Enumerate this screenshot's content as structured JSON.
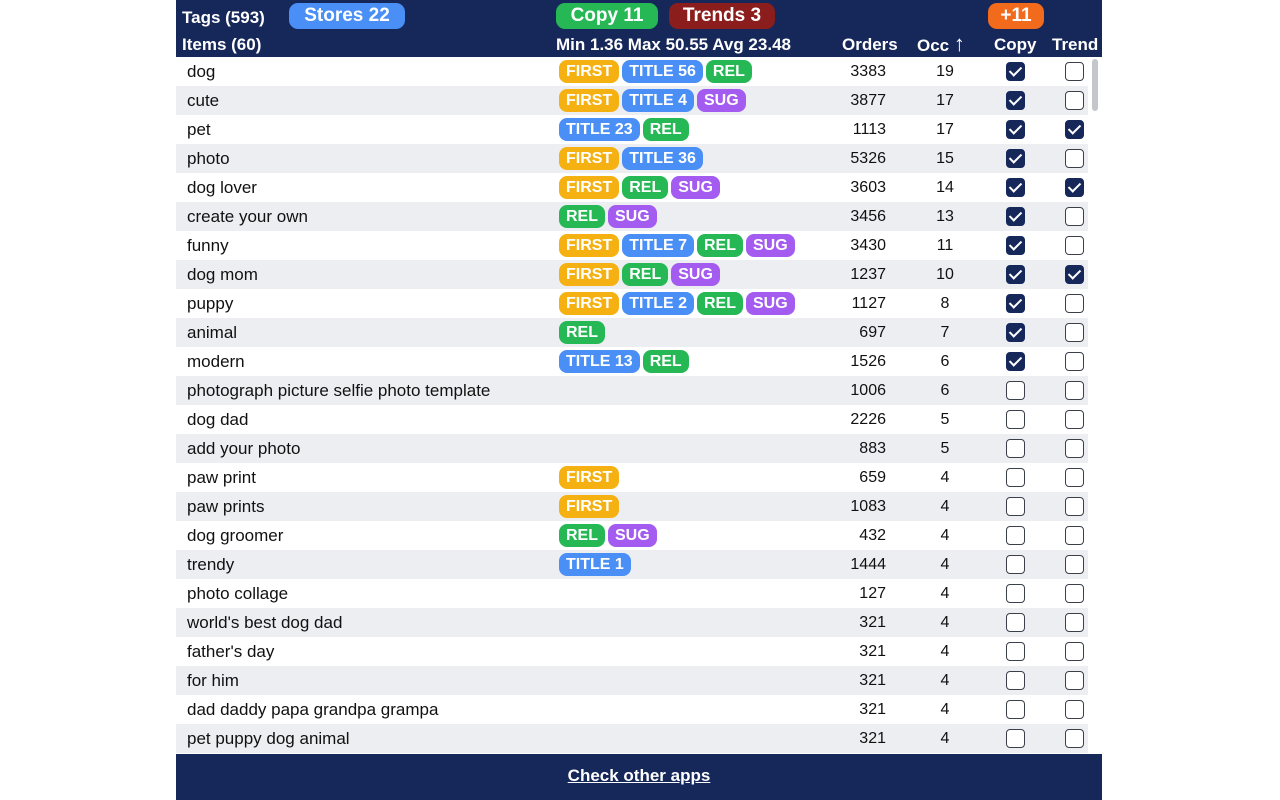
{
  "header": {
    "tags_label": "Tags (593)",
    "items_label": "Items (60)",
    "stores_button": "Stores 22",
    "copy_button": "Copy 11",
    "trends_button": "Trends 3",
    "plus_button": "+11",
    "stats": "Min 1.36 Max 50.55 Avg 23.48",
    "col_orders": "Orders",
    "col_occ": "Occ",
    "sort_icon": "↑",
    "col_copy": "Copy",
    "col_trend": "Trend"
  },
  "colors": {
    "panel_bg": "#16275a",
    "stores": "#4a8ff5",
    "copy": "#27b856",
    "trends": "#8c1d1d",
    "plus": "#f26b1d",
    "badge_first": "#f5b111",
    "badge_title": "#4a8ff5",
    "badge_rel": "#27b856",
    "badge_sug": "#a45cf0"
  },
  "rows": [
    {
      "keyword": "dog",
      "badges": [
        "FIRST",
        "TITLE 56",
        "REL"
      ],
      "orders": "3383",
      "occ": "19",
      "copy": true,
      "trend": false
    },
    {
      "keyword": "cute",
      "badges": [
        "FIRST",
        "TITLE 4",
        "SUG"
      ],
      "orders": "3877",
      "occ": "17",
      "copy": true,
      "trend": false
    },
    {
      "keyword": "pet",
      "badges": [
        "TITLE 23",
        "REL"
      ],
      "orders": "1113",
      "occ": "17",
      "copy": true,
      "trend": true
    },
    {
      "keyword": "photo",
      "badges": [
        "FIRST",
        "TITLE 36"
      ],
      "orders": "5326",
      "occ": "15",
      "copy": true,
      "trend": false
    },
    {
      "keyword": "dog lover",
      "badges": [
        "FIRST",
        "REL",
        "SUG"
      ],
      "orders": "3603",
      "occ": "14",
      "copy": true,
      "trend": true
    },
    {
      "keyword": "create your own",
      "badges": [
        "REL",
        "SUG"
      ],
      "orders": "3456",
      "occ": "13",
      "copy": true,
      "trend": false
    },
    {
      "keyword": "funny",
      "badges": [
        "FIRST",
        "TITLE 7",
        "REL",
        "SUG"
      ],
      "orders": "3430",
      "occ": "11",
      "copy": true,
      "trend": false
    },
    {
      "keyword": "dog mom",
      "badges": [
        "FIRST",
        "REL",
        "SUG"
      ],
      "orders": "1237",
      "occ": "10",
      "copy": true,
      "trend": true
    },
    {
      "keyword": "puppy",
      "badges": [
        "FIRST",
        "TITLE 2",
        "REL",
        "SUG"
      ],
      "orders": "1127",
      "occ": "8",
      "copy": true,
      "trend": false
    },
    {
      "keyword": "animal",
      "badges": [
        "REL"
      ],
      "orders": "697",
      "occ": "7",
      "copy": true,
      "trend": false
    },
    {
      "keyword": "modern",
      "badges": [
        "TITLE 13",
        "REL"
      ],
      "orders": "1526",
      "occ": "6",
      "copy": true,
      "trend": false
    },
    {
      "keyword": "photograph picture selfie photo template",
      "badges": [],
      "orders": "1006",
      "occ": "6",
      "copy": false,
      "trend": false
    },
    {
      "keyword": "dog dad",
      "badges": [],
      "orders": "2226",
      "occ": "5",
      "copy": false,
      "trend": false
    },
    {
      "keyword": "add your photo",
      "badges": [],
      "orders": "883",
      "occ": "5",
      "copy": false,
      "trend": false
    },
    {
      "keyword": "paw print",
      "badges": [
        "FIRST"
      ],
      "orders": "659",
      "occ": "4",
      "copy": false,
      "trend": false
    },
    {
      "keyword": "paw prints",
      "badges": [
        "FIRST"
      ],
      "orders": "1083",
      "occ": "4",
      "copy": false,
      "trend": false
    },
    {
      "keyword": "dog groomer",
      "badges": [
        "REL",
        "SUG"
      ],
      "orders": "432",
      "occ": "4",
      "copy": false,
      "trend": false
    },
    {
      "keyword": "trendy",
      "badges": [
        "TITLE 1"
      ],
      "orders": "1444",
      "occ": "4",
      "copy": false,
      "trend": false
    },
    {
      "keyword": "photo collage",
      "badges": [],
      "orders": "127",
      "occ": "4",
      "copy": false,
      "trend": false
    },
    {
      "keyword": "world's best dog dad",
      "badges": [],
      "orders": "321",
      "occ": "4",
      "copy": false,
      "trend": false
    },
    {
      "keyword": "father's day",
      "badges": [],
      "orders": "321",
      "occ": "4",
      "copy": false,
      "trend": false
    },
    {
      "keyword": "for him",
      "badges": [],
      "orders": "321",
      "occ": "4",
      "copy": false,
      "trend": false
    },
    {
      "keyword": "dad daddy papa grandpa grampa",
      "badges": [],
      "orders": "321",
      "occ": "4",
      "copy": false,
      "trend": false
    },
    {
      "keyword": "pet puppy dog animal",
      "badges": [],
      "orders": "321",
      "occ": "4",
      "copy": false,
      "trend": false
    }
  ],
  "footer": {
    "link": "Check other apps"
  }
}
